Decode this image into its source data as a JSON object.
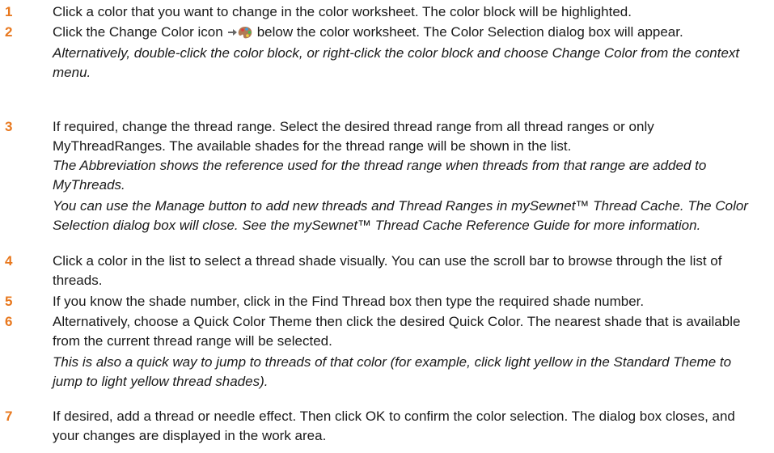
{
  "steps": [
    {
      "number": "1",
      "text": "Click a color that you want to change in the color worksheet. The color block will be highlighted."
    },
    {
      "number": "2",
      "text_before_icon": "Click the Change Color icon",
      "icon": "change-color-icon",
      "text_after_icon": "below the color worksheet. The Color Selection dialog box will appear.",
      "notes": [
        "Alternatively, double-click the color block, or right-click the color block and choose Change Color from the context menu."
      ]
    },
    {
      "number": "3",
      "text": "If required, change the thread range. Select the desired thread range from all thread ranges or only MyThreadRanges. The available shades for the thread range will be shown in the list.",
      "notes": [
        "The Abbreviation shows the reference used for the thread range when threads from that range are added to MyThreads.",
        "You can use the Manage button to add new threads and Thread Ranges in mySewnet™ Thread Cache. The Color Selection dialog box will close. See the mySewnet™ Thread Cache Reference Guide for more information."
      ]
    },
    {
      "number": "4",
      "text": "Click a color in the list to select a thread shade visually. You can use the scroll bar to browse through the list of threads."
    },
    {
      "number": "5",
      "text": "If you know the shade number, click in the Find Thread box then type the required shade number."
    },
    {
      "number": "6",
      "text": "Alternatively, choose a Quick Color Theme then click the desired Quick Color. The nearest shade that is available from the current thread range will be selected.",
      "notes": [
        "This is also a quick way to jump to threads of that color (for example, click light yellow in the Standard Theme to jump to light yellow thread shades)."
      ]
    },
    {
      "number": "7",
      "text": "If desired, add a thread or needle effect. Then click OK to confirm the color selection. The dialog box closes, and your changes are displayed in the work area."
    }
  ],
  "colors": {
    "step_number": "#e8781e",
    "body_text": "#1a1a1a"
  }
}
